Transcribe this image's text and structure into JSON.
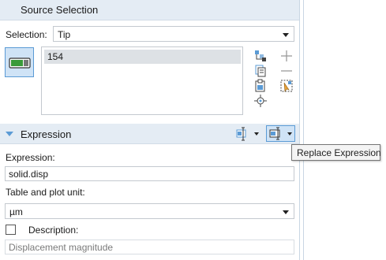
{
  "source_selection": {
    "title": "Source Selection",
    "selection_label": "Selection:",
    "selection_value": "Tip",
    "list_items": [
      "154"
    ],
    "active_toggle_icon": "selection-toggle-icon",
    "tools": [
      "paste-selection-icon",
      "add-icon",
      "copy-selection-icon",
      "remove-icon",
      "clear-selection-icon",
      "zoom-to-selection-icon",
      "create-selection-icon"
    ]
  },
  "expression_section": {
    "title": "Expression",
    "header_tools": [
      "insert-expression-icon",
      "replace-expression-icon"
    ],
    "expression_label": "Expression:",
    "expression_value": "solid.disp",
    "unit_label": "Table and plot unit:",
    "unit_value": "µm",
    "description_label": "Description:",
    "description_checked": false,
    "description_value": "Displacement magnitude"
  },
  "tooltip": {
    "text": "Replace Expression"
  },
  "colors": {
    "header_bg": "#e4ecf4",
    "accent": "#5b9bd5",
    "active_bg": "#cfe3f6"
  }
}
